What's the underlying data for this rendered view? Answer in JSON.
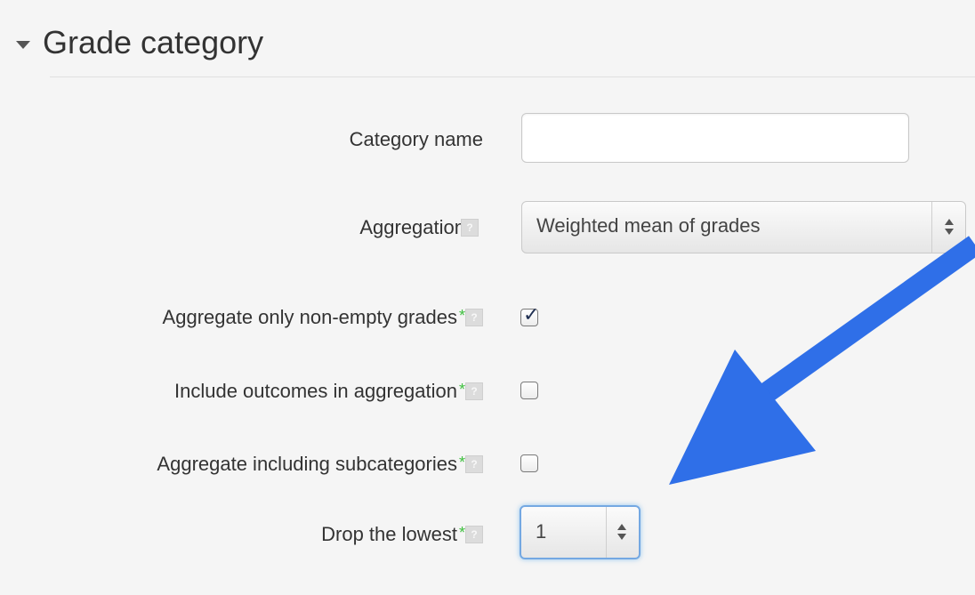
{
  "section": {
    "title": "Grade category"
  },
  "fields": {
    "category_name": {
      "label": "Category name",
      "value": ""
    },
    "aggregation": {
      "label": "Aggregation",
      "value": "Weighted mean of grades"
    },
    "aggregate_only_non_empty": {
      "label": "Aggregate only non-empty grades",
      "required_mark": "*",
      "checked": true
    },
    "include_outcomes": {
      "label": "Include outcomes in aggregation",
      "required_mark": "*",
      "checked": false
    },
    "aggregate_including_subcategories": {
      "label": "Aggregate including subcategories",
      "required_mark": "*",
      "checked": false
    },
    "drop_lowest": {
      "label": "Drop the lowest",
      "required_mark": "*",
      "value": "1"
    }
  },
  "help_icon_glyph": "?",
  "colors": {
    "required_mark": "#3fbf3f",
    "focus_ring": "#74a8e2",
    "annotation_arrow": "#2f6fe8",
    "checkmark": "#1f2f52"
  },
  "icons": {
    "collapse": "caret-down-icon",
    "help": "help-icon",
    "select": "select-arrows-icon",
    "annotation": "arrow-pointer-icon"
  }
}
